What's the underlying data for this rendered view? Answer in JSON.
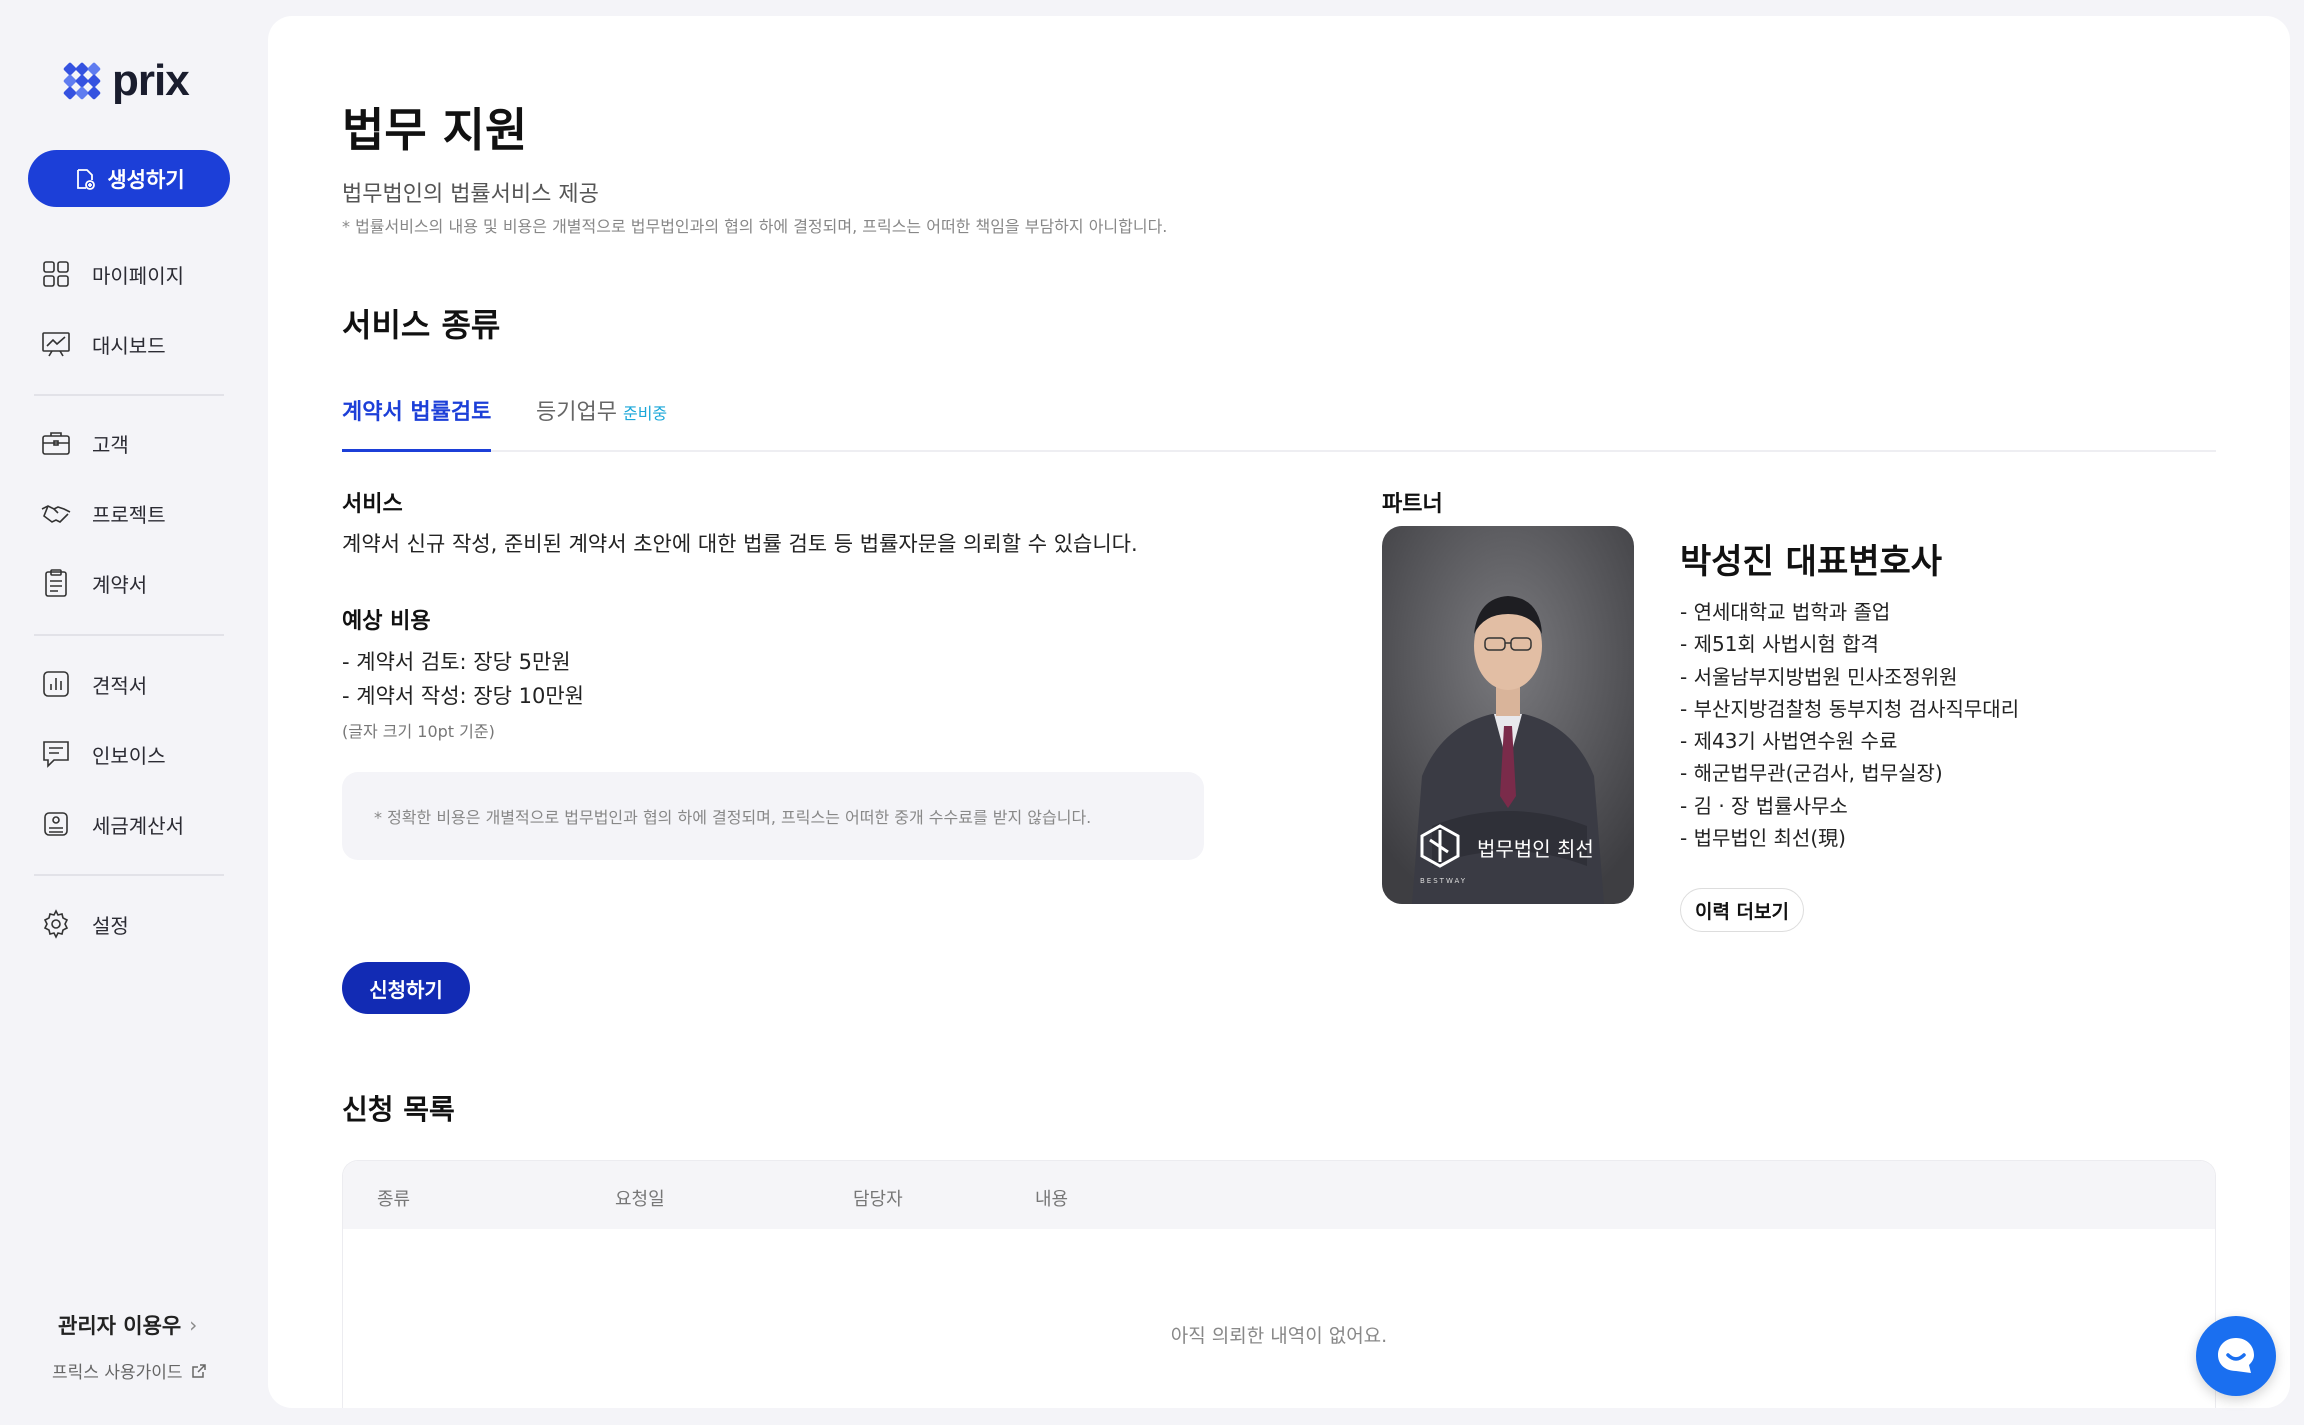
{
  "brand": {
    "name": "prix",
    "color": "#1c3fd8"
  },
  "sidebar": {
    "create_label": "생성하기",
    "items": [
      {
        "label": "마이페이지",
        "icon": "grid-icon"
      },
      {
        "label": "대시보드",
        "icon": "chart-board-icon"
      },
      {
        "label": "고객",
        "icon": "briefcase-icon"
      },
      {
        "label": "프로젝트",
        "icon": "handshake-icon"
      },
      {
        "label": "계약서",
        "icon": "clipboard-icon"
      },
      {
        "label": "견적서",
        "icon": "bar-chart-icon"
      },
      {
        "label": "인보이스",
        "icon": "invoice-icon"
      },
      {
        "label": "세금계산서",
        "icon": "tax-receipt-icon"
      },
      {
        "label": "설정",
        "icon": "gear-icon"
      }
    ],
    "admin_label": "관리자 이용우",
    "guide_label": "프릭스 사용가이드"
  },
  "page": {
    "title": "법무 지원",
    "subtitle": "법무법인의 법률서비스 제공",
    "notice": "* 법률서비스의 내용 및 비용은 개별적으로 법무법인과의 협의 하에 결정되며, 프릭스는 어떠한 책임을 부담하지 아니합니다."
  },
  "services": {
    "title": "서비스 종류",
    "tabs": [
      {
        "label": "계약서 법률검토",
        "active": true
      },
      {
        "label": "등기업무",
        "badge": "준비중"
      }
    ],
    "service_label": "서비스",
    "service_desc": "계약서 신규 작성, 준비된 계약서 초안에 대한 법률 검토 등 법률자문을 의뢰할 수 있습니다.",
    "cost_label": "예상 비용",
    "costs": [
      "- 계약서 검토: 장당 5만원",
      "- 계약서 작성: 장당 10만원"
    ],
    "cost_note": "(글자 크기 10pt 기준)",
    "cost_notice": "* 정확한 비용은 개별적으로 법무법인과 협의 하에 결정되며, 프릭스는 어떠한 중개 수수료를 받지 않습니다.",
    "apply_label": "신청하기"
  },
  "partner": {
    "label": "파트너",
    "photo_caption": "법무법인 최선",
    "photo_sub": "BESTWAY",
    "name": "박성진 대표변호사",
    "career": [
      "- 연세대학교 법학과 졸업",
      "- 제51회 사법시험 합격",
      "- 서울남부지방법원 민사조정위원",
      "- 부산지방검찰청 동부지청 검사직무대리",
      "- 제43기 사법연수원 수료",
      "- 해군법무관(군검사, 법무실장)",
      "- 김 · 장 법률사무소",
      "- 법무법인 최선(現)"
    ],
    "more_label": "이력 더보기"
  },
  "requests": {
    "title": "신청 목록",
    "columns": [
      "종류",
      "요청일",
      "담당자",
      "내용"
    ],
    "empty": "아직 의뢰한 내역이 없어요."
  }
}
